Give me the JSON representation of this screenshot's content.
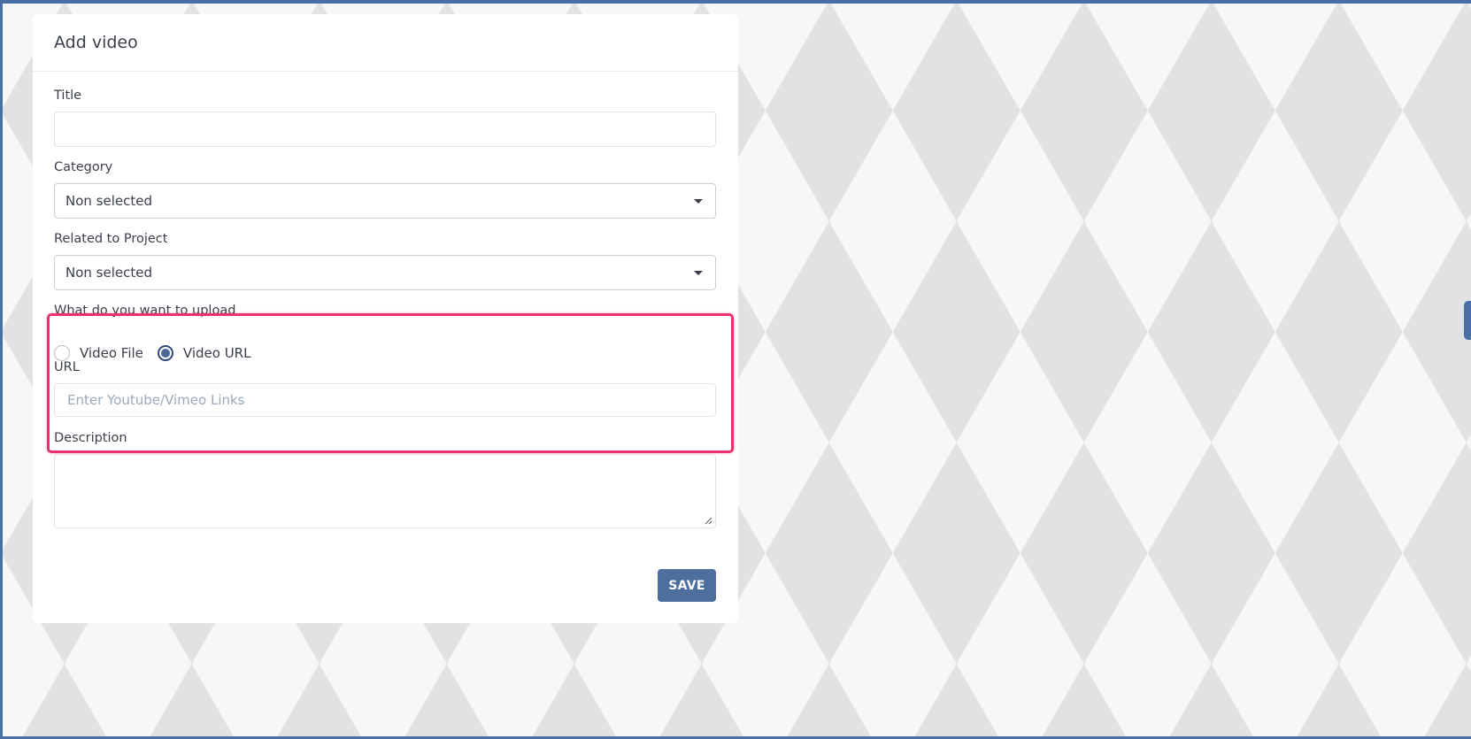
{
  "page": {
    "card_title": "Add video"
  },
  "form": {
    "title": {
      "label": "Title",
      "value": ""
    },
    "category": {
      "label": "Category",
      "selected": "Non selected"
    },
    "related_project": {
      "label": "Related to Project",
      "selected": "Non selected"
    },
    "upload_type": {
      "label": "What do you want to upload",
      "options": [
        "Video File",
        "Video URL"
      ],
      "selected": "Video URL"
    },
    "url": {
      "label": "URL",
      "placeholder": "Enter Youtube/Vimeo Links",
      "value": ""
    },
    "description": {
      "label": "Description",
      "value": ""
    },
    "save_label": "SAVE"
  },
  "colors": {
    "accent": "#4e6e9e",
    "highlight": "#e8336a"
  },
  "icons": {
    "select_caret": "caret-down-icon",
    "textarea_resize": "resize-handle-icon"
  }
}
